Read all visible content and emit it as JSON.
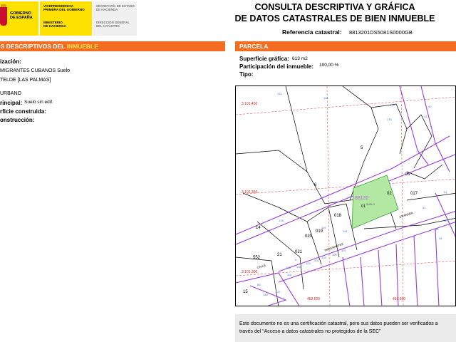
{
  "header": {
    "gov_logo": "Gobierno de España",
    "ministry_lines_1": [
      "Vicepresidencia",
      "Primera del Gobierno"
    ],
    "ministry_lines_2": [
      "Ministerio",
      "de Hacienda"
    ],
    "secretariat_lines": [
      "Secretaría de Estado",
      "de Hacienda"
    ],
    "direction_lines": [
      "Dirección General",
      "del Catastro"
    ],
    "title_line1": "CONSULTA DESCRIPTIVA Y GRÁFICA",
    "title_line2": "DE DATOS CATASTRALES DE BIEN INMUEBLE",
    "ref_label": "Referencia catastral:",
    "ref_value": "8813201DS5081S0000GB"
  },
  "left_panel": {
    "bar_prefix": "OS DESCRIPTIVOS DEL ",
    "bar_highlight": "INMUEBLE",
    "location_label": "ización:",
    "address_line1": "MIGRANTES CUBANOS  Suelo",
    "address_line2": "TELDE [LAS PALMAS]",
    "class_value": "URBANO",
    "use_label": "rincipal:",
    "use_value": "Suelo sin edif.",
    "built_area_label": "rficie construida:",
    "construction_label": "onstrucción:"
  },
  "right_panel": {
    "bar_label": "PARCELA",
    "surface_label": "Superficie gráfica:",
    "surface_value": "613 m2",
    "share_label": "Participación del inmueble:",
    "share_value": "100,00 %",
    "type_label": "Tipo:"
  },
  "map": {
    "coord_top": "3.101.400",
    "coord_mid": "3.101.350",
    "coord_bottom": "3.101.300",
    "coord_x1": "459.600",
    "coord_x2": "459.650",
    "parcel_ref": "88132",
    "parcel_sub": "01",
    "parcel_use": "SUELO",
    "street_1": "GRANADA",
    "street_2": "INMIGRANTES",
    "street_3": "CALLE",
    "plot_labels": [
      "5",
      "6",
      "01",
      "02",
      "017",
      "018",
      "019",
      "020",
      "021",
      "14",
      "552",
      "21",
      "15"
    ],
    "numbers": [
      "175",
      "176",
      "41",
      "476",
      "40",
      "45",
      "46",
      "170",
      "118",
      "119",
      "51",
      "51",
      "52",
      "65",
      "150",
      "116",
      "106",
      "108",
      "104",
      "102",
      "103",
      "100",
      "101",
      "116",
      "8",
      "27"
    ]
  },
  "footer": {
    "line1": "Este documento no es una certificación catastral, pero sus datos pueden ser verificados a",
    "line2_pre": "través del “Acceso a datos catastrales no protegidos de la SEC”"
  }
}
